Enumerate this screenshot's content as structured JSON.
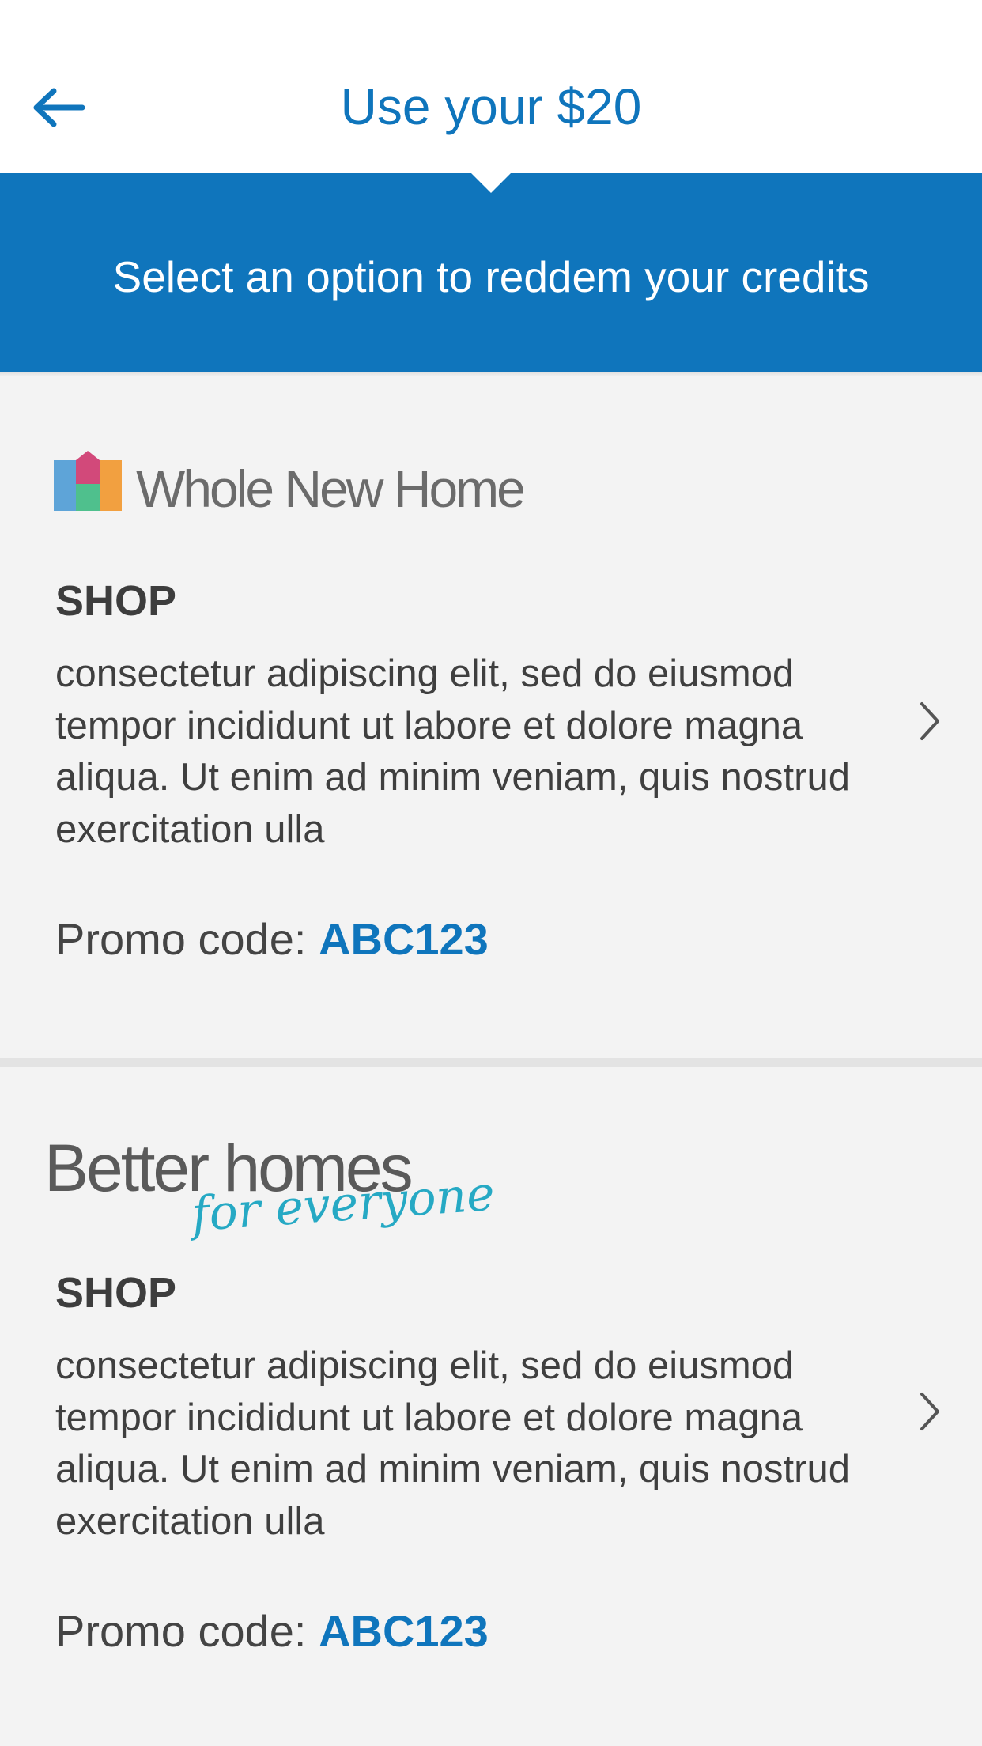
{
  "header": {
    "title": "Use your $20",
    "back_icon": "arrow-left-icon"
  },
  "banner": {
    "text": "Select an option to reddem your credits"
  },
  "offers": [
    {
      "brand": "Whole New Home",
      "category": "SHOP",
      "description": "consectetur adipiscing elit, sed do eiusmod tempor incididunt ut labore et dolore magna aliqua. Ut enim ad minim veniam, quis nostrud exercitation ulla",
      "promo_label": "Promo code:",
      "promo_code": "ABC123",
      "chevron_icon": "chevron-right-icon"
    },
    {
      "brand": "Better homes",
      "brand_tagline": "for everyone",
      "category": "SHOP",
      "description": "consectetur adipiscing elit, sed do eiusmod tempor incididunt ut labore et dolore magna aliqua. Ut enim ad minim veniam, quis nostrud exercitation ulla",
      "promo_label": "Promo code:",
      "promo_code": "ABC123",
      "chevron_icon": "chevron-right-icon"
    }
  ],
  "colors": {
    "accent": "#0f75bc",
    "background": "#f3f3f3",
    "text": "#3f3f3f",
    "tagline": "#26a9c4"
  }
}
